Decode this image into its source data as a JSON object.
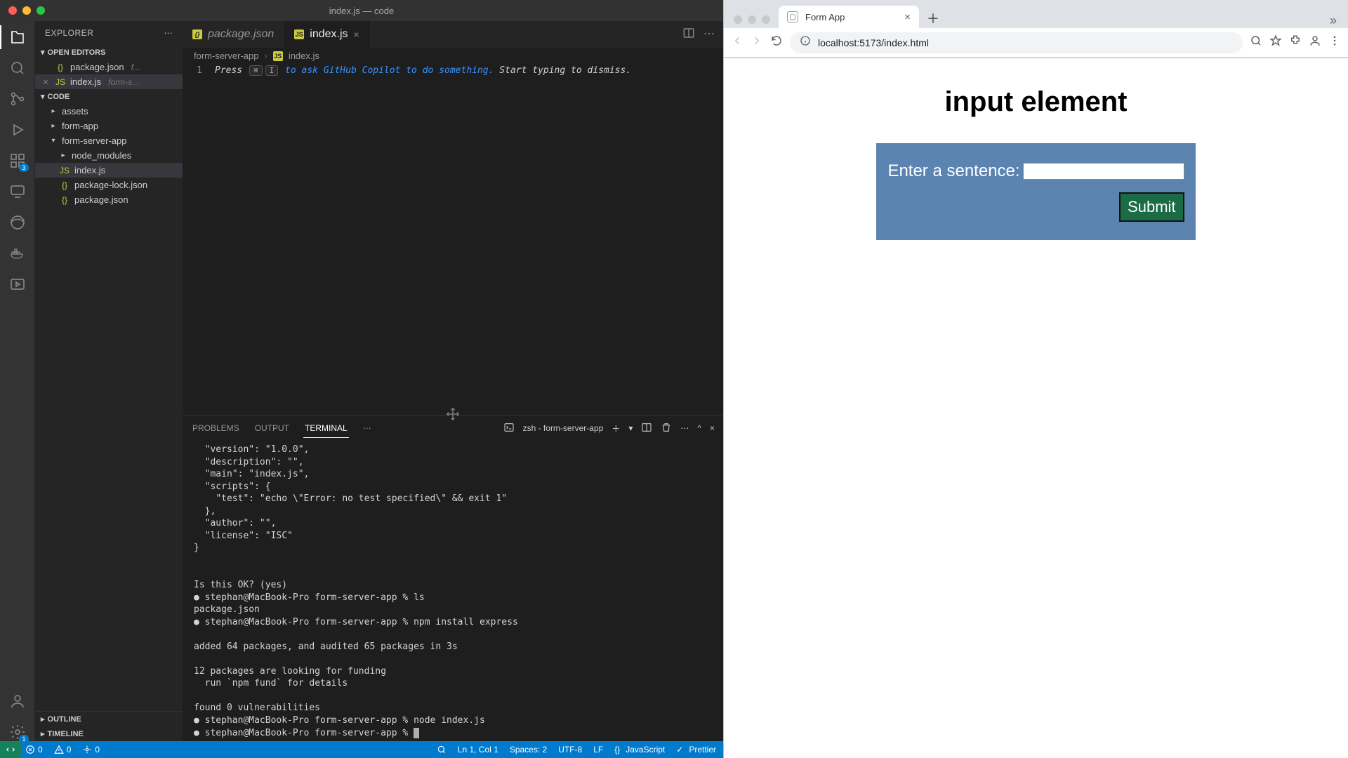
{
  "vscode": {
    "title": "index.js — code",
    "explorer": {
      "label": "EXPLORER",
      "open_editors_label": "OPEN EDITORS",
      "code_label": "CODE",
      "outline_label": "OUTLINE",
      "timeline_label": "TIMELINE",
      "open_editors": [
        {
          "name": "package.json",
          "meta": "f..."
        },
        {
          "name": "index.js",
          "meta": "form-s..."
        }
      ],
      "tree": {
        "assets": "assets",
        "form_app": "form-app",
        "form_server_app": "form-server-app",
        "node_modules": "node_modules",
        "index_js": "index.js",
        "package_lock": "package-lock.json",
        "package_json": "package.json"
      }
    },
    "tabs": {
      "package_json": "package.json",
      "index_js": "index.js"
    },
    "breadcrumb": {
      "root": "form-server-app",
      "file": "index.js"
    },
    "editor": {
      "line1_num": "1",
      "hint_pre": "Press ",
      "hint_k1": "⌘",
      "hint_k2": "I",
      "hint_link": " to ask GitHub Copilot to do something.",
      "hint_post": " Start typing to dismiss."
    },
    "panel": {
      "problems": "PROBLEMS",
      "output": "OUTPUT",
      "terminal": "TERMINAL",
      "shell": "zsh - form-server-app"
    },
    "terminal_text": "  \"version\": \"1.0.0\",\n  \"description\": \"\",\n  \"main\": \"index.js\",\n  \"scripts\": {\n    \"test\": \"echo \\\"Error: no test specified\\\" && exit 1\"\n  },\n  \"author\": \"\",\n  \"license\": \"ISC\"\n}\n\n\nIs this OK? (yes)\n● stephan@MacBook-Pro form-server-app % ls\npackage.json\n● stephan@MacBook-Pro form-server-app % npm install express\n\nadded 64 packages, and audited 65 packages in 3s\n\n12 packages are looking for funding\n  run `npm fund` for details\n\nfound 0 vulnerabilities\n● stephan@MacBook-Pro form-server-app % node index.js\n● stephan@MacBook-Pro form-server-app % ",
    "status": {
      "errors": "0",
      "warnings": "0",
      "ports": "0",
      "lncol": "Ln 1, Col 1",
      "spaces": "Spaces: 2",
      "enc": "UTF-8",
      "eol": "LF",
      "lang": "JavaScript",
      "prettier": "Prettier"
    },
    "activity_badge": "3",
    "gear_badge": "1"
  },
  "chrome": {
    "tab_title": "Form App",
    "url": "localhost:5173/index.html",
    "page": {
      "heading": "input element",
      "label": "Enter a sentence:",
      "submit": "Submit"
    }
  }
}
